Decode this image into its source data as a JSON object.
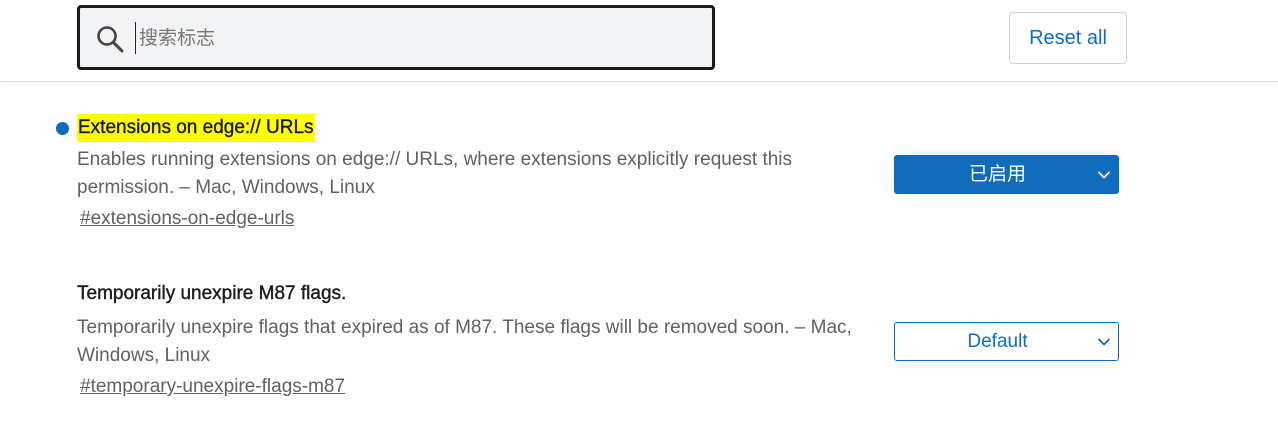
{
  "search": {
    "placeholder": "搜索标志",
    "value": ""
  },
  "header": {
    "reset_label": "Reset all"
  },
  "flags": [
    {
      "title": "Extensions on edge:// URLs",
      "description": "Enables running extensions on edge:// URLs, where extensions explicitly request this permission. – Mac, Windows, Linux",
      "link": "#extensions-on-edge-urls",
      "selected": "已启用",
      "modified": true,
      "highlighted": true
    },
    {
      "title": "Temporarily unexpire M87 flags.",
      "description": "Temporarily unexpire flags that expired as of M87. These flags will be removed soon. – Mac, Windows, Linux",
      "link": "#temporary-unexpire-flags-m87",
      "selected": "Default",
      "modified": false,
      "highlighted": false
    }
  ],
  "colors": {
    "accent": "#0f6cbd",
    "highlight": "#ffff00",
    "muted_text": "#616161"
  },
  "icons": {
    "search": "search-icon",
    "dropdown": "chevron-down-icon",
    "modified_indicator": "modified-dot"
  }
}
